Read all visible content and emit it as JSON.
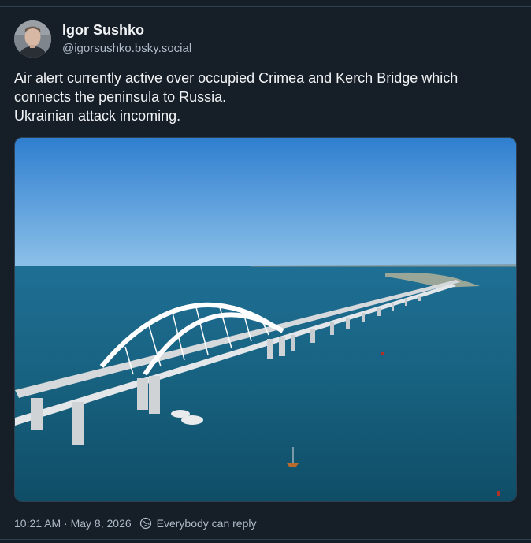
{
  "post": {
    "author_name": "Igor Sushko",
    "author_handle": "@igorsushko.bsky.social",
    "text_lines": [
      "Air alert currently active over occupied Crimea and Kerch Bridge which",
      "connects the peninsula to Russia.",
      "Ukrainian attack incoming."
    ],
    "timestamp": "10:21 AM · May 8, 2026",
    "reply_setting": "Everybody can reply"
  },
  "icons": {
    "avatar": "avatar-photo",
    "reply": "globe-reply-icon"
  },
  "colors": {
    "background": "#161e27",
    "text": "#f1f3f5",
    "muted": "#aebbc9",
    "border": "#2e4052"
  }
}
